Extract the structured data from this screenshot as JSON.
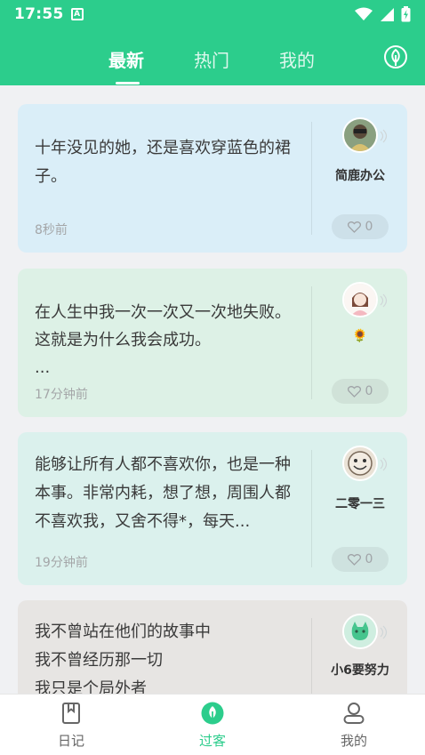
{
  "status_bar": {
    "time": "17:55",
    "notification_icon": "A"
  },
  "top_tabs": {
    "latest": "最新",
    "hot": "热门",
    "mine": "我的"
  },
  "feed": [
    {
      "text": "十年没见的她，还是喜欢穿蓝色的裙子。",
      "time": "8秒前",
      "username": "简鹿办公",
      "likes": "0",
      "bg": "#daeef8"
    },
    {
      "text": "在人生中我一次一次又一次地失败。这就是为什么我会成功。\n...",
      "time": "17分钟前",
      "username": "🌻",
      "likes": "0",
      "bg": "#ddf1e6"
    },
    {
      "text": "能够让所有人都不喜欢你，也是一种本事。非常内耗，想了想，周围人都不喜欢我，又舍不得*，每天...",
      "time": "19分钟前",
      "username": "二零一三",
      "likes": "0",
      "bg": "#dbf1ed"
    },
    {
      "text": "我不曾站在他们的故事中\n我不曾经历那一切\n我只是个局外者",
      "username": "小6要努力",
      "bg": "#e7e5e3"
    }
  ],
  "bottom_nav": {
    "diary": "日记",
    "visitor": "过客",
    "mine": "我的"
  },
  "colors": {
    "primary": "#2ccd8c"
  }
}
